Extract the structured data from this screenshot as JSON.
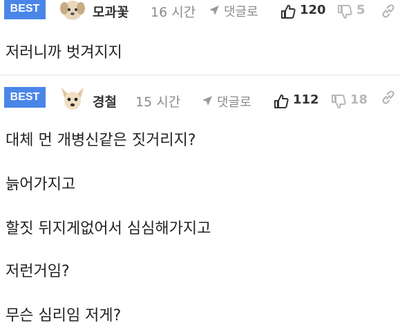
{
  "comments": [
    {
      "badge": "BEST",
      "nickname": "모과꽃",
      "time": "16 시간",
      "reply_label": "댓글로",
      "likes": "120",
      "dislikes": "5",
      "avatar": "puppy-avatar",
      "lines": [
        "저러니까 벗겨지지"
      ]
    },
    {
      "badge": "BEST",
      "nickname": "경철",
      "time": "15 시간",
      "reply_label": "댓글로",
      "likes": "112",
      "dislikes": "18",
      "avatar": "chihuahua-avatar",
      "lines": [
        "대체 먼 개병신같은 짓거리지?",
        "늙어가지고",
        "할짓 뒤지게없어서 심심해가지고",
        "저런거임?",
        "무슨 심리임 저게?"
      ]
    }
  ],
  "colors": {
    "best_badge": "#4a86e8",
    "muted": "#8a8a8a",
    "text": "#222222"
  },
  "icons": [
    "reply-arrow-icon",
    "thumbs-up-icon",
    "thumbs-down-icon",
    "link-icon"
  ]
}
